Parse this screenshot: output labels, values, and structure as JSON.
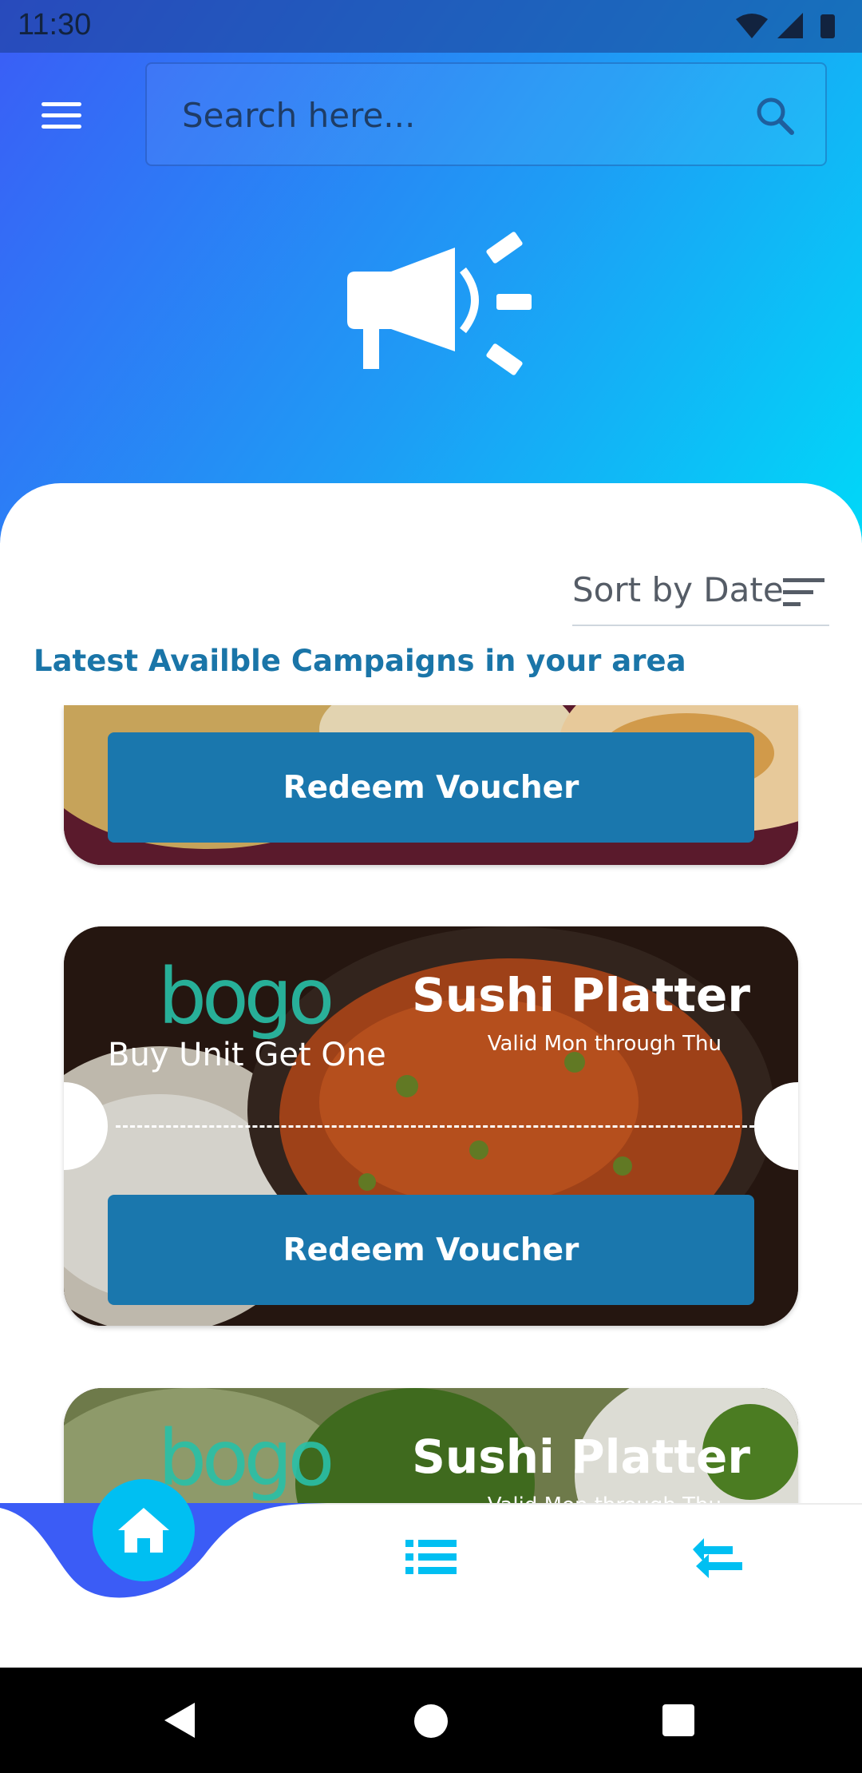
{
  "status_bar": {
    "time": "11:30"
  },
  "search": {
    "placeholder": "Search here..."
  },
  "sort": {
    "label": "Sort by Date"
  },
  "section": {
    "title": "Latest Availble Campaigns in your area"
  },
  "campaigns": [
    {
      "button_label": "Redeem Voucher"
    },
    {
      "brand": "bogo",
      "offer": "Buy Unit Get One",
      "title": "Sushi Platter",
      "valid": "Valid Mon through Thu",
      "button_label": "Redeem Voucher"
    },
    {
      "brand": "bogo",
      "title": "Sushi Platter",
      "valid": "Valid Mon through Thu"
    }
  ],
  "colors": {
    "header_gradient": [
      "#3b5cf6",
      "#00d8f8"
    ],
    "accent": "#1a77ad",
    "nav_active": "#00bff2",
    "nav_wave": "#3b5cf6"
  },
  "icons": {
    "menu": "hamburger-icon",
    "search": "search-icon",
    "hero": "megaphone-icon",
    "sort": "sort-lines-icon",
    "home": "home-icon",
    "list": "list-icon",
    "swap": "compress-arrows-icon"
  }
}
